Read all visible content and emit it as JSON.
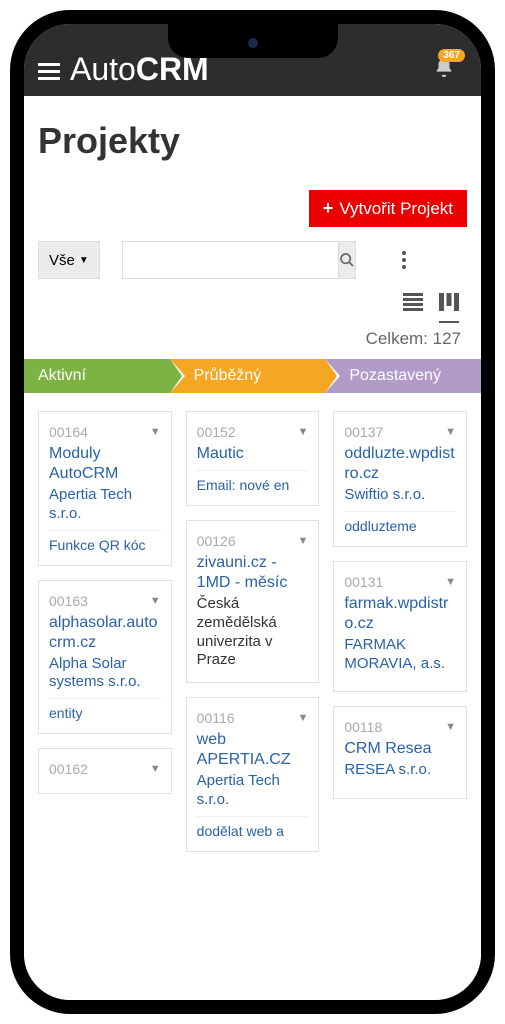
{
  "header": {
    "logo_light": "Auto",
    "logo_bold": "CRM",
    "notification_count": "367"
  },
  "page": {
    "title": "Projekty",
    "create_label": "Vytvořit Projekt",
    "filter_label": "Vše",
    "total_label": "Celkem: 127"
  },
  "stages": [
    "Aktivní",
    "Průběžný",
    "Pozastavený"
  ],
  "columns": [
    [
      {
        "num": "00164",
        "title": "Moduly AutoCRM",
        "sub": "Apertia Tech s.r.o.",
        "extra": "Funkce QR kóc"
      },
      {
        "num": "00163",
        "title": "alphasolar.autocrm.cz",
        "sub": "Alpha Solar systems s.r.o.",
        "extra": "entity"
      },
      {
        "num": "00162",
        "title": ""
      }
    ],
    [
      {
        "num": "00152",
        "title": "Mautic",
        "extra": "Email: nové en"
      },
      {
        "num": "00126",
        "title": "zivauni.cz - 1MD - měsíc",
        "sub_dark": "Česká zemědělská univerzita v Praze"
      },
      {
        "num": "00116",
        "title": "web APERTIA.CZ",
        "sub": "Apertia Tech s.r.o.",
        "extra": "dodělat web a"
      }
    ],
    [
      {
        "num": "00137",
        "title": "oddluzte.wpdistro.cz",
        "sub": "Swiftio s.r.o.",
        "extra": "oddluzteme"
      },
      {
        "num": "00131",
        "title": "farmak.wpdistro.cz",
        "sub": "FARMAK MORAVIA, a.s."
      },
      {
        "num": "00118",
        "title": "CRM Resea",
        "sub": "RESEA s.r.o."
      }
    ]
  ]
}
